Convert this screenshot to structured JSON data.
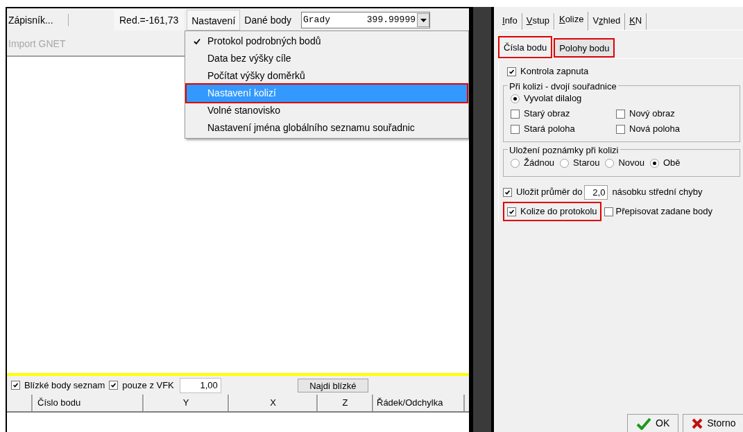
{
  "left_window": {
    "toolbar": {
      "notebook": "Zápisník...",
      "reduction": "Red.=-161,73",
      "menus": [
        {
          "label": "Nastavení",
          "selected": true
        },
        {
          "label": "Dané body",
          "selected": false
        }
      ],
      "unit_combo": {
        "unit": "Grady",
        "value": "399.99999"
      }
    },
    "import_button": {
      "label": "Import GNET",
      "disabled": true
    },
    "menu": {
      "items": [
        {
          "label": "Protokol podrobných bodů",
          "checked": true,
          "selected": false,
          "highlighted": false
        },
        {
          "label": "Data bez výšky cíle",
          "checked": false,
          "selected": false,
          "highlighted": false
        },
        {
          "label": "Počítat výšky doměrků",
          "checked": false,
          "selected": false,
          "highlighted": false
        },
        {
          "label": "Nastavení kolizí",
          "checked": false,
          "selected": true,
          "highlighted": true
        },
        {
          "label": "Volné stanovisko",
          "checked": false,
          "selected": false,
          "highlighted": false
        },
        {
          "label": "Nastavení jména globálního seznamu souřadnic",
          "checked": false,
          "selected": false,
          "highlighted": false
        }
      ]
    },
    "search_bar": {
      "nearby_list": {
        "label": "Blízké body seznam",
        "checked": true
      },
      "only_vfk": {
        "label": "pouze z VFK",
        "checked": true
      },
      "distance": "1,00",
      "find_button": "Najdi blízké"
    },
    "table": {
      "columns": [
        "Číslo bodu",
        "Y",
        "X",
        "Z",
        "Řádek/Odchylka"
      ]
    }
  },
  "settings_panel": {
    "tabs": [
      {
        "key": "I",
        "post": "nfo",
        "selected": false
      },
      {
        "key": "V",
        "post": "stup",
        "selected": false
      },
      {
        "key": "K",
        "post": "olize",
        "selected": true
      },
      {
        "pre": "V",
        "key": "z",
        "post": "hled",
        "selected": false
      },
      {
        "key": "K",
        "post": "N",
        "selected": false
      }
    ],
    "subtabs": [
      {
        "label": "Čísla bodu",
        "selected": true,
        "highlighted": true
      },
      {
        "label": "Polohy bodu",
        "selected": false,
        "highlighted": true
      }
    ],
    "check_enabled": {
      "label": "Kontrola zapnuta",
      "checked": true
    },
    "collision_group": {
      "title": "Při kolizi - dvojí souřadnice",
      "options": [
        {
          "kind": "radio",
          "label": "Vyvolat dilalog",
          "checked": true
        },
        {
          "kind": "checkbox",
          "label": "Starý obraz",
          "checked": false
        },
        {
          "kind": "checkbox",
          "label": "Nový obraz",
          "checked": false
        },
        {
          "kind": "checkbox",
          "label": "Stará poloha",
          "checked": false
        },
        {
          "kind": "checkbox",
          "label": "Nová poloha",
          "checked": false
        }
      ]
    },
    "note_group": {
      "title": "Uložení poznámky při kolizi",
      "options": [
        {
          "label": "Žádnou",
          "checked": false
        },
        {
          "label": "Starou",
          "checked": false
        },
        {
          "label": "Novou",
          "checked": false
        },
        {
          "label": "Obě",
          "checked": true
        }
      ]
    },
    "average": {
      "label": "Uložit průměr do",
      "checked": true,
      "value": "2,0",
      "suffix": "násobku střední chyby"
    },
    "protocol": {
      "label": "Kolize do protokolu",
      "checked": true,
      "highlighted": true
    },
    "overwrite": {
      "label": "Přepisovat zadane body",
      "checked": false
    },
    "buttons": [
      {
        "kind": "ok",
        "label": "OK"
      },
      {
        "kind": "cancel",
        "label": "Storno"
      }
    ]
  }
}
